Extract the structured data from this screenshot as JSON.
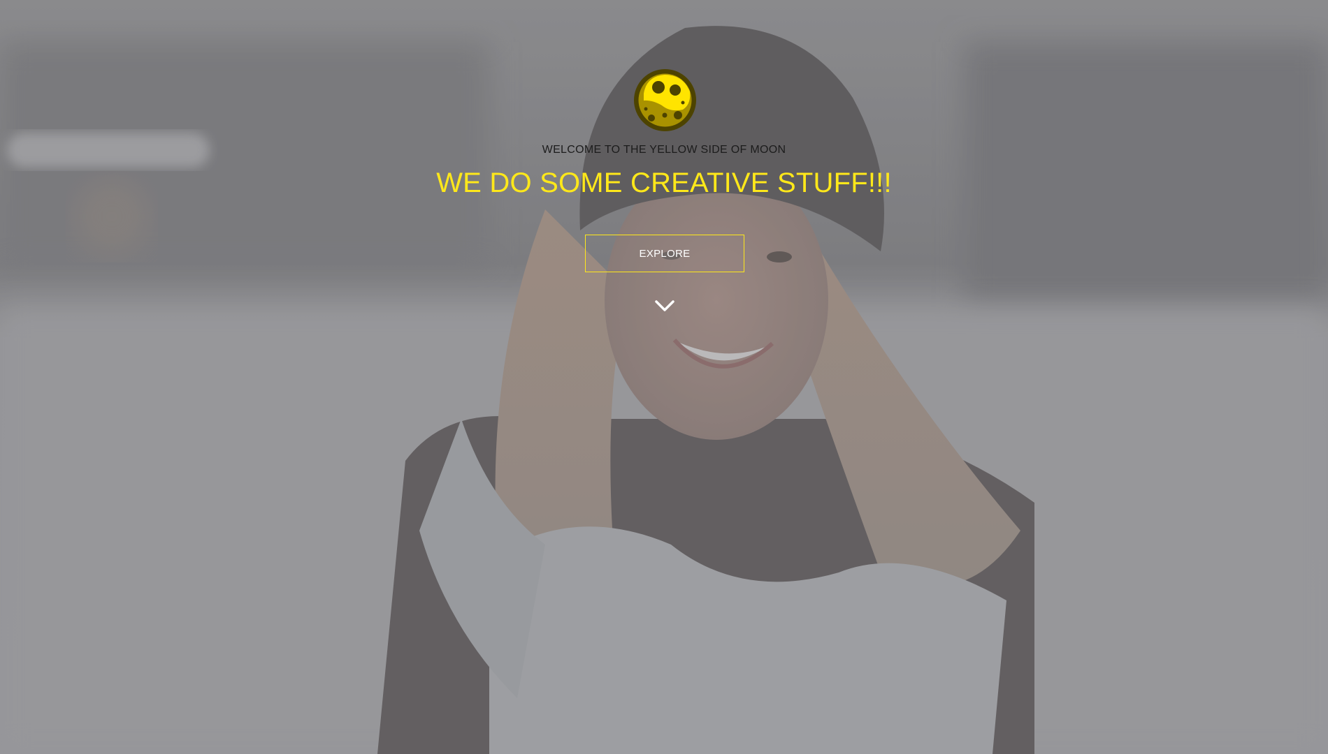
{
  "hero": {
    "welcome_text": "WELCOME TO THE YELLOW SIDE OF MOON",
    "headline": "WE DO SOME CREATIVE STUFF!!!",
    "explore_label": "EXPLORE",
    "logo_icon": "moon-logo-icon",
    "scroll_icon": "chevron-down-icon"
  },
  "colors": {
    "accent": "#ffe81a",
    "overlay": "#8c8c8f",
    "welcome_text": "#1c1c1c",
    "button_text": "#ffffff",
    "logo_dark": "#4d4300"
  }
}
